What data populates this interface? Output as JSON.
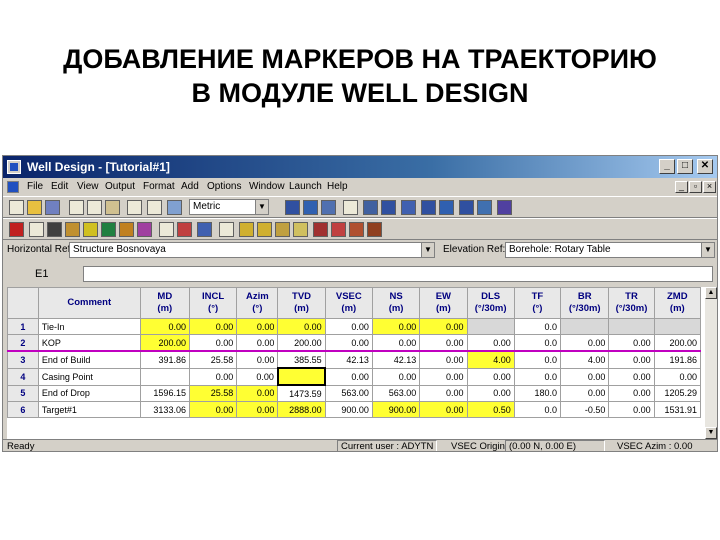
{
  "slide": {
    "title_line1": "ДОБАВЛЕНИЕ МАРКЕРОВ НА ТРАЕКТОРИЮ",
    "title_line2": "В МОДУЛЕ WELL DESIGN"
  },
  "window": {
    "title": "Well Design - [Tutorial#1]",
    "controls": [
      "_",
      "□",
      "✕"
    ]
  },
  "menu": {
    "items": [
      "File",
      "Edit",
      "View",
      "Output",
      "Format",
      "Add",
      "Options",
      "Window",
      "Launch",
      "Help"
    ],
    "mdi_controls": [
      "_",
      "▫",
      "×"
    ]
  },
  "toolbar": {
    "unit_select": "Metric"
  },
  "refs": {
    "horizontal_label": "Horizontal Ref:",
    "horizontal_value": "Structure Bosnovaya",
    "elevation_label": "Elevation Ref:",
    "elevation_value": "Borehole: Rotary Table"
  },
  "edit": {
    "cell_ref": "E1",
    "value": ""
  },
  "grid": {
    "columns": [
      {
        "name": "Comment",
        "unit": ""
      },
      {
        "name": "MD",
        "unit": "(m)"
      },
      {
        "name": "INCL",
        "unit": "(°)"
      },
      {
        "name": "Azim",
        "unit": "(°)"
      },
      {
        "name": "TVD",
        "unit": "(m)"
      },
      {
        "name": "VSEC",
        "unit": "(m)"
      },
      {
        "name": "NS",
        "unit": "(m)"
      },
      {
        "name": "EW",
        "unit": "(m)"
      },
      {
        "name": "DLS",
        "unit": "(°/30m)"
      },
      {
        "name": "TF",
        "unit": "(°)"
      },
      {
        "name": "BR",
        "unit": "(°/30m)"
      },
      {
        "name": "TR",
        "unit": "(°/30m)"
      },
      {
        "name": "ZMD",
        "unit": "(m)"
      }
    ],
    "rows": [
      {
        "num": "1",
        "cells": [
          "Tie-In",
          "0.00",
          "0.00",
          "0.00",
          "0.00",
          "0.00",
          "0.00",
          "0.00",
          "",
          "0.0",
          "",
          "",
          ""
        ]
      },
      {
        "num": "2",
        "cells": [
          "KOP",
          "200.00",
          "0.00",
          "0.00",
          "200.00",
          "0.00",
          "0.00",
          "0.00",
          "0.00",
          "0.0",
          "0.00",
          "0.00",
          "200.00"
        ]
      },
      {
        "num": "3",
        "cells": [
          "End of Build",
          "391.86",
          "25.58",
          "0.00",
          "385.55",
          "42.13",
          "42.13",
          "0.00",
          "4.00",
          "0.0",
          "4.00",
          "0.00",
          "191.86"
        ]
      },
      {
        "num": "4",
        "cells": [
          "Casing Point",
          "",
          "0.00",
          "0.00",
          "",
          "0.00",
          "0.00",
          "0.00",
          "0.00",
          "0.0",
          "0.00",
          "0.00",
          "0.00"
        ]
      },
      {
        "num": "5",
        "cells": [
          "End of Drop",
          "1596.15",
          "25.58",
          "0.00",
          "1473.59",
          "563.00",
          "563.00",
          "0.00",
          "0.00",
          "180.0",
          "0.00",
          "0.00",
          "1205.29"
        ]
      },
      {
        "num": "6",
        "cells": [
          "Target#1",
          "3133.06",
          "0.00",
          "0.00",
          "2888.00",
          "900.00",
          "900.00",
          "0.00",
          "0.50",
          "0.0",
          "-0.50",
          "0.00",
          "1531.91"
        ]
      }
    ]
  },
  "status": {
    "ready": "Ready",
    "user": "Current user : ADYTN",
    "vsec_origin_label": "VSEC Origin",
    "vsec_origin_value": "(0.00 N, 0.00 E)",
    "vsec_azim": "VSEC Azim : 0.00"
  }
}
